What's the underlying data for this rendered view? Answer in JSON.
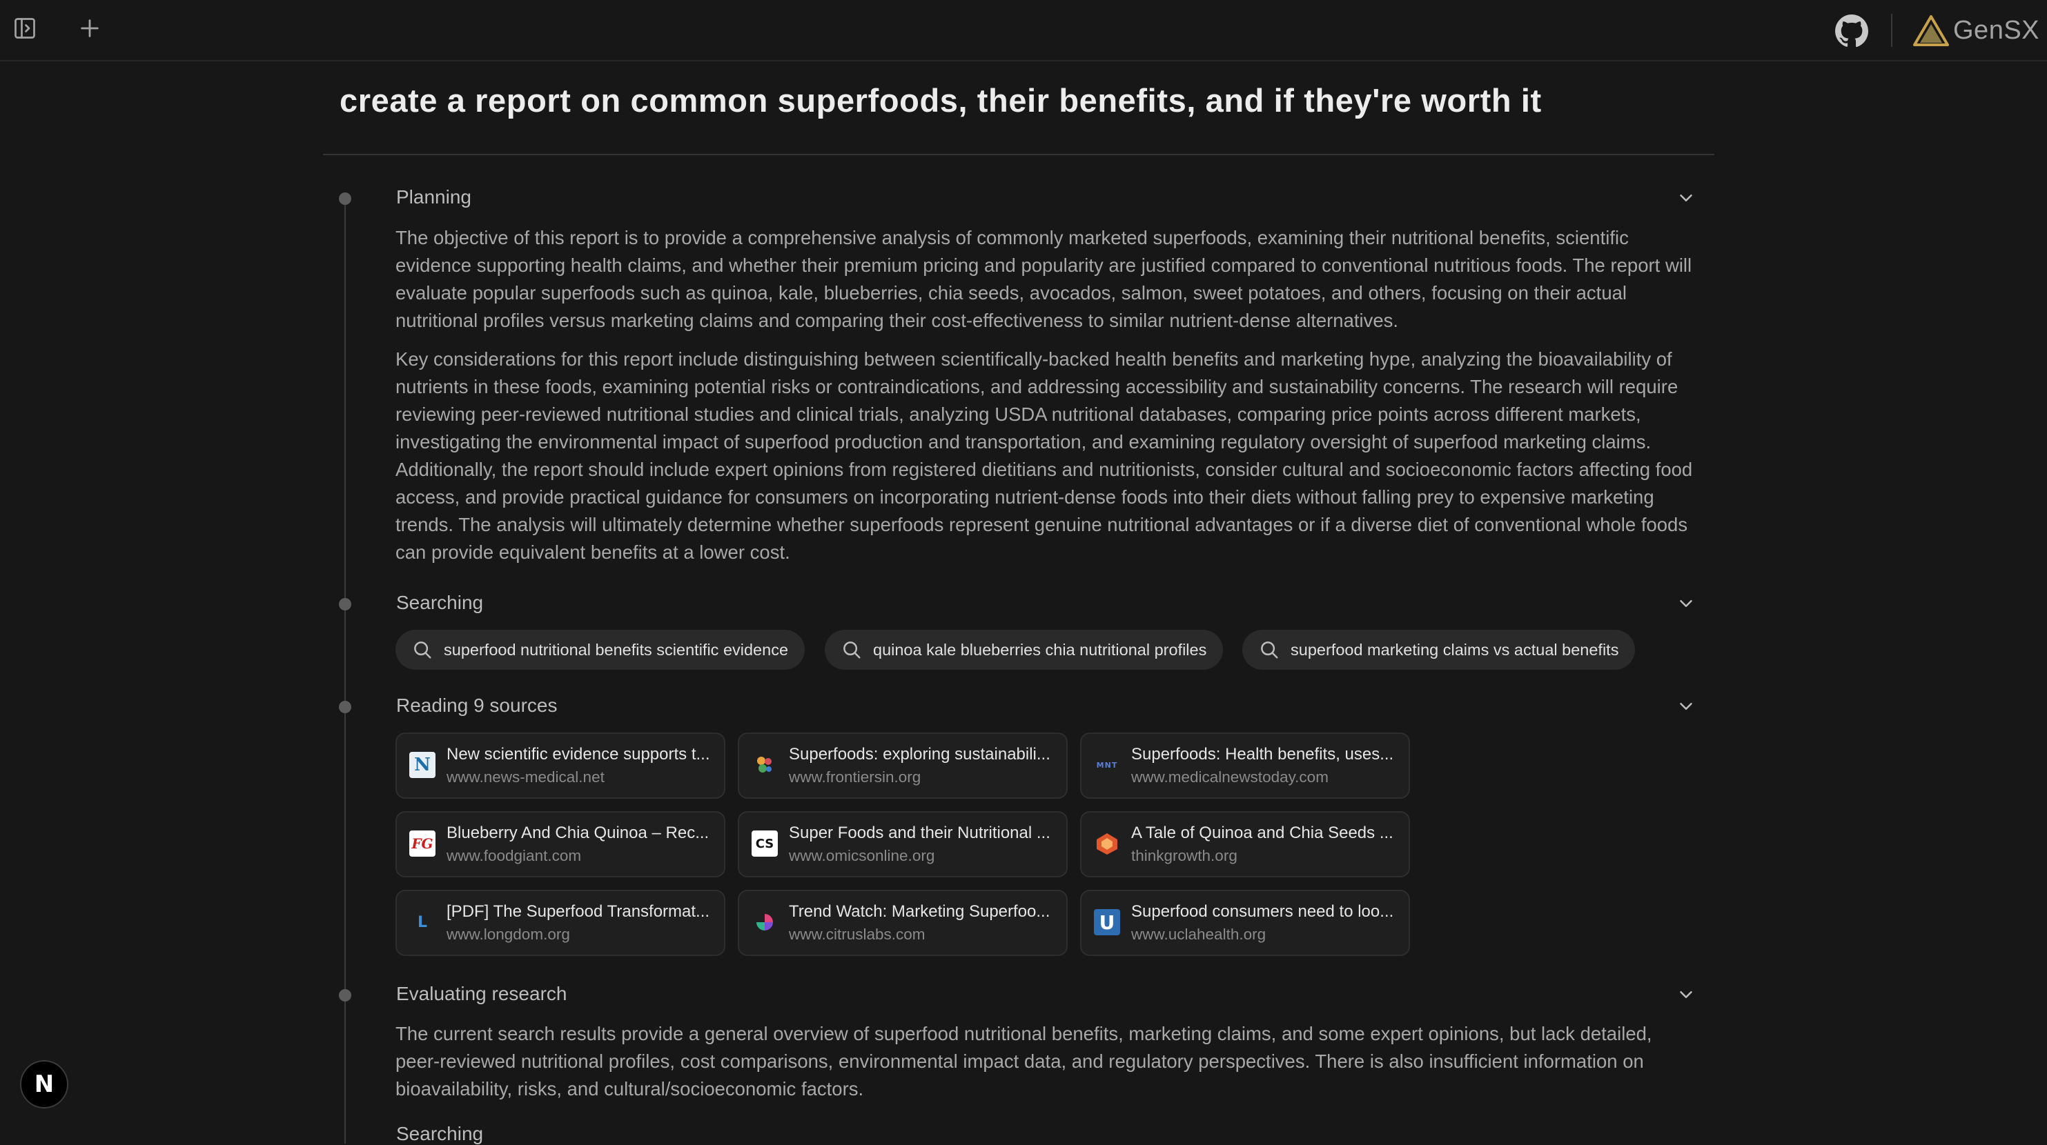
{
  "header": {
    "brand": "GenSX",
    "colors": {
      "background": "#171717",
      "brand_triangle": "#c8a24a"
    }
  },
  "report": {
    "title": "create a report on common superfoods, their benefits, and if they're worth it"
  },
  "planning": {
    "title": "Planning",
    "paragraphs": [
      "The objective of this report is to provide a comprehensive analysis of commonly marketed superfoods, examining their nutritional benefits, scientific evidence supporting health claims, and whether their premium pricing and popularity are justified compared to conventional nutritious foods. The report will evaluate popular superfoods such as quinoa, kale, blueberries, chia seeds, avocados, salmon, sweet potatoes, and others, focusing on their actual nutritional profiles versus marketing claims and comparing their cost-effectiveness to similar nutrient-dense alternatives.",
      "Key considerations for this report include distinguishing between scientifically-backed health benefits and marketing hype, analyzing the bioavailability of nutrients in these foods, examining potential risks or contraindications, and addressing accessibility and sustainability concerns. The research will require reviewing peer-reviewed nutritional studies and clinical trials, analyzing USDA nutritional databases, comparing price points across different markets, investigating the environmental impact of superfood production and transportation, and examining regulatory oversight of superfood marketing claims. Additionally, the report should include expert opinions from registered dietitians and nutritionists, consider cultural and socioeconomic factors affecting food access, and provide practical guidance for consumers on incorporating nutrient-dense foods into their diets without falling prey to expensive marketing trends. The analysis will ultimately determine whether superfoods represent genuine nutritional advantages or if a diverse diet of conventional whole foods can provide equivalent benefits at a lower cost."
    ]
  },
  "searching": {
    "title": "Searching",
    "queries": [
      "superfood nutritional benefits scientific evidence",
      "quinoa kale blueberries chia nutritional profiles",
      "superfood marketing claims vs actual benefits"
    ]
  },
  "reading": {
    "title": "Reading 9 sources",
    "sources": [
      {
        "title": "New scientific evidence supports t...",
        "url": "www.news-medical.net",
        "favicon": "N",
        "icon": "news-medical-icon"
      },
      {
        "title": "Superfoods: exploring sustainabili...",
        "url": "www.frontiersin.org",
        "favicon": "",
        "icon": "frontiers-icon"
      },
      {
        "title": "Superfoods: Health benefits, uses...",
        "url": "www.medicalnewstoday.com",
        "favicon": "MNT",
        "icon": "mnt-icon"
      },
      {
        "title": "Blueberry And Chia Quinoa – Rec...",
        "url": "www.foodgiant.com",
        "favicon": "FG",
        "icon": "foodgiant-icon"
      },
      {
        "title": "Super Foods and their Nutritional ...",
        "url": "www.omicsonline.org",
        "favicon": "CS",
        "icon": "omics-icon"
      },
      {
        "title": "A Tale of Quinoa and Chia Seeds ...",
        "url": "thinkgrowth.org",
        "favicon": "",
        "icon": "thinkgrowth-icon"
      },
      {
        "title": "[PDF] The Superfood Transformat...",
        "url": "www.longdom.org",
        "favicon": "L",
        "icon": "longdom-icon"
      },
      {
        "title": "Trend Watch: Marketing Superfoo...",
        "url": "www.citruslabs.com",
        "favicon": "",
        "icon": "citruslabs-icon"
      },
      {
        "title": "Superfood consumers need to loo...",
        "url": "www.uclahealth.org",
        "favicon": "U",
        "icon": "ucla-icon"
      }
    ]
  },
  "evaluating": {
    "title": "Evaluating research",
    "paragraph": "The current search results provide a general overview of superfood nutritional benefits, marketing claims, and some expert opinions, but lack detailed, peer-reviewed nutritional profiles, cost comparisons, environmental impact data, and regulatory perspectives. There is also insufficient information on bioavailability, risks, and cultural/socioeconomic factors."
  },
  "next_section": {
    "title": "Searching"
  },
  "dev_badge": {
    "label": "N"
  }
}
